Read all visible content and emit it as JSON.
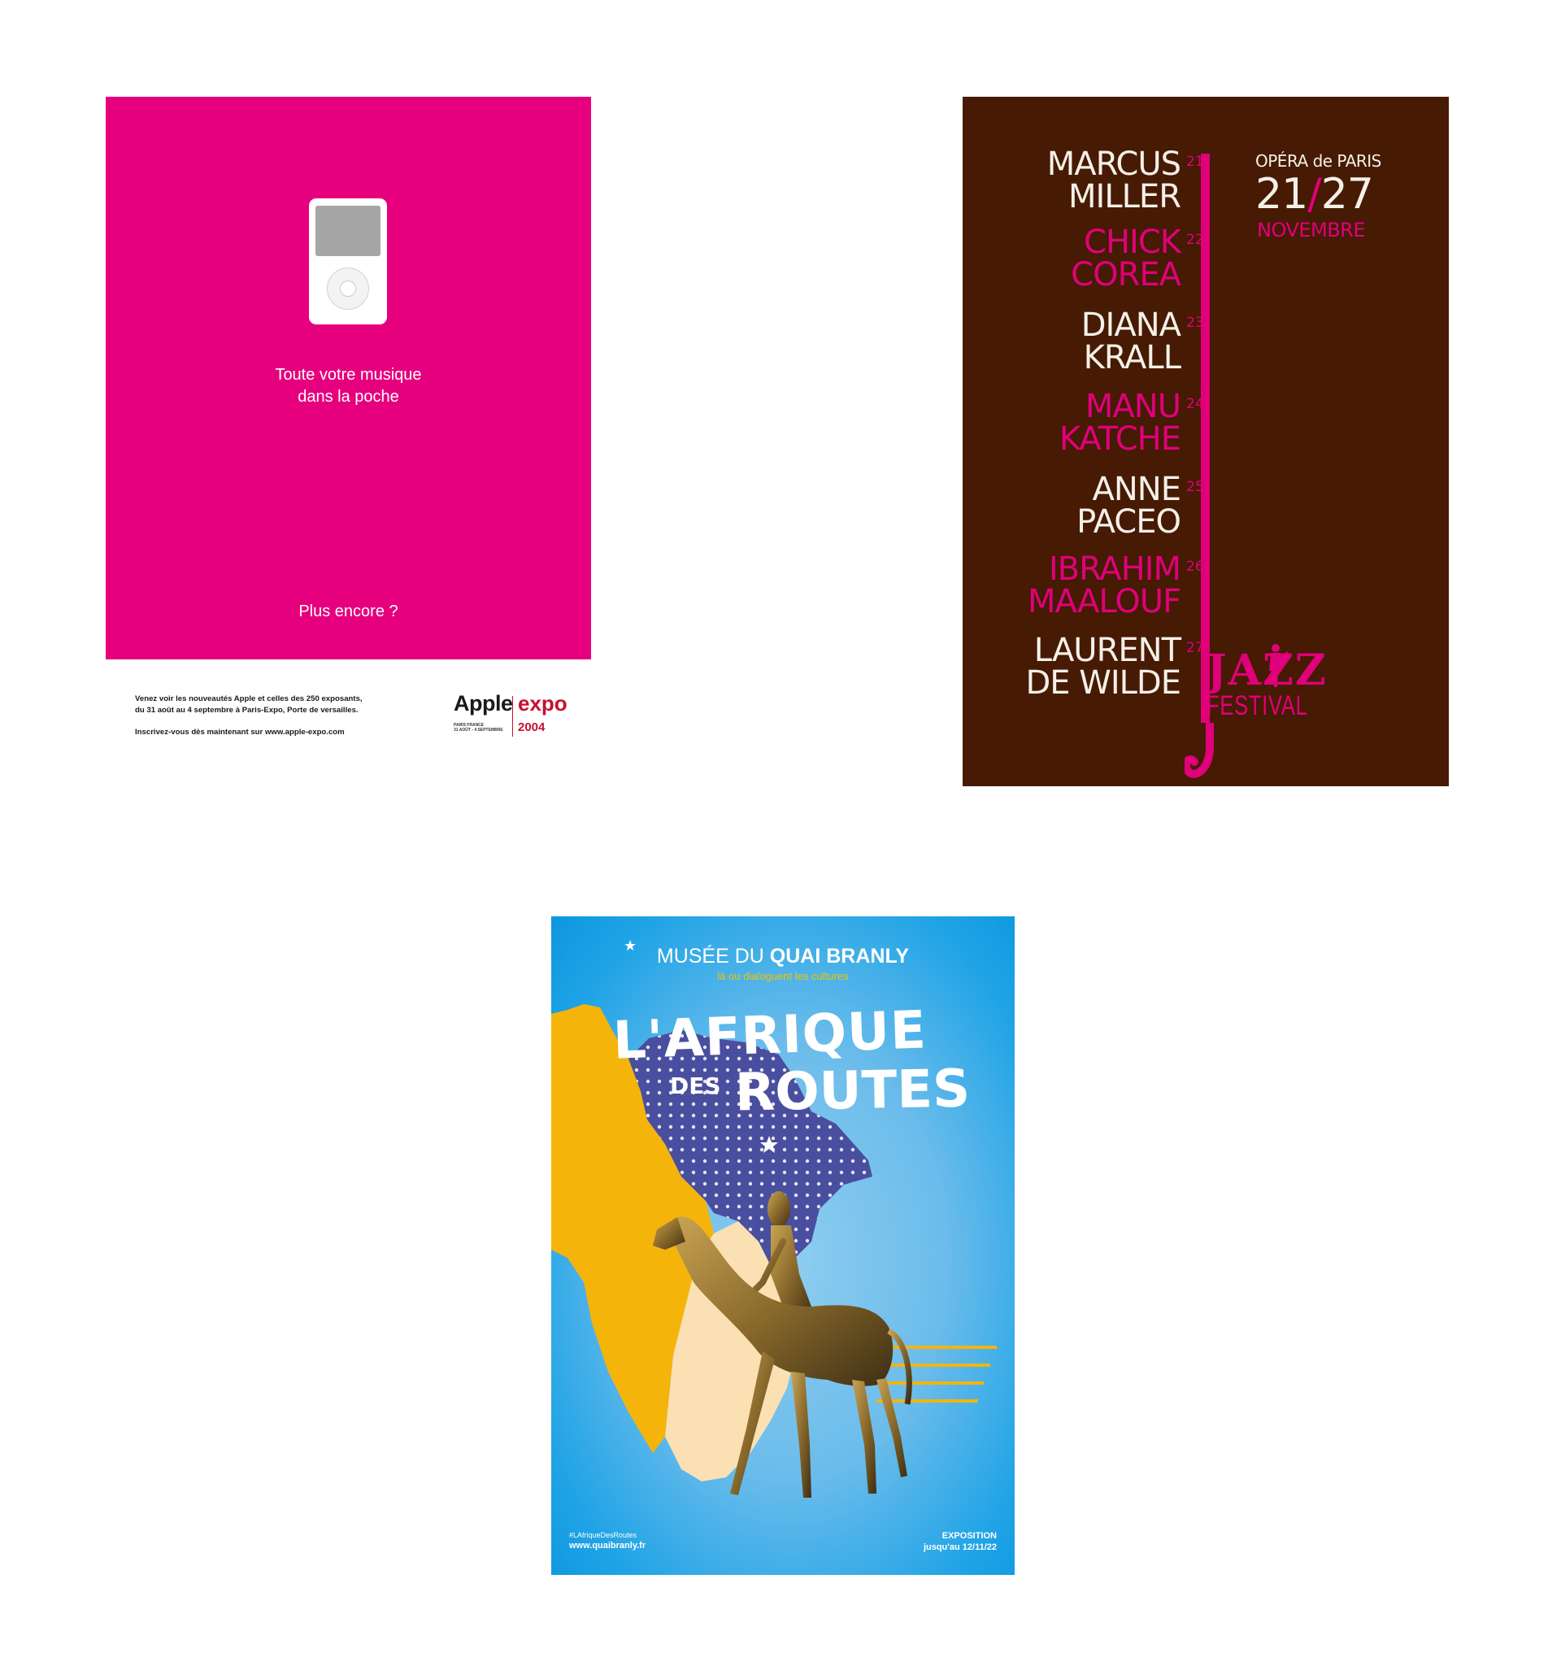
{
  "apple_poster": {
    "headline_line1": "Toute votre musique",
    "headline_line2": "dans la poche",
    "more": "Plus encore ?",
    "footer_line1": "Venez voir les nouveautés Apple et celles des 250 exposants,",
    "footer_line2": "du 31 août au 4 septembre à Paris-Expo, Porte de versailles.",
    "footer_line3": "Inscrivez-vous dès maintenant sur www.apple-expo.com",
    "logo_apple": "Apple",
    "logo_expo": "expo",
    "logo_year": "2004",
    "logo_small_line1": "PARIS FRANCE",
    "logo_small_line2": "31 AOÛT - 4 SEPTEMBRE",
    "background_color": "#e6007e"
  },
  "jazz_poster": {
    "artists": [
      {
        "line1": "MARCUS",
        "line2": "MILLER",
        "day": "21",
        "color": "white"
      },
      {
        "line1": "CHICK",
        "line2": "COREA",
        "day": "22",
        "color": "pink"
      },
      {
        "line1": "DIANA",
        "line2": "KRALL",
        "day": "23",
        "color": "white"
      },
      {
        "line1": "MANU",
        "line2": "KATCHE",
        "day": "24",
        "color": "pink"
      },
      {
        "line1": "ANNE",
        "line2": "PACEO",
        "day": "25",
        "color": "white"
      },
      {
        "line1": "IBRAHIM",
        "line2": "MAALOUF",
        "day": "26",
        "color": "pink"
      },
      {
        "line1": "LAURENT",
        "line2": "DE WILDE",
        "day": "27",
        "color": "white"
      }
    ],
    "venue": "OPÉRA de PARIS",
    "date_start": "21",
    "date_sep": "/",
    "date_end": "27",
    "month": "NOVEMBRE",
    "logo_jazz": "JAZZ",
    "logo_festival": "FESTIVAL",
    "background_color": "#461a03",
    "accent_color": "#e0007a"
  },
  "branly_poster": {
    "museum_prefix": "MUSÉE DU ",
    "museum_name": "QUAI BRANLY",
    "tagline": "là ou dialoguent les cultures",
    "title_line1": "L'AFRIQUE",
    "title_des": "DES",
    "title_line2": "ROUTES",
    "hashtag": "#LAfriqueDesRoutes",
    "website": "www.quaibranly.fr",
    "exhibition_label": "EXPOSITION",
    "exhibition_until": "jusqu'au 12/11/22",
    "colors": {
      "sky": "#21a4e6",
      "yellow": "#f5b40a",
      "navy": "#4a4e9e",
      "sand": "#fbe0b4"
    }
  }
}
